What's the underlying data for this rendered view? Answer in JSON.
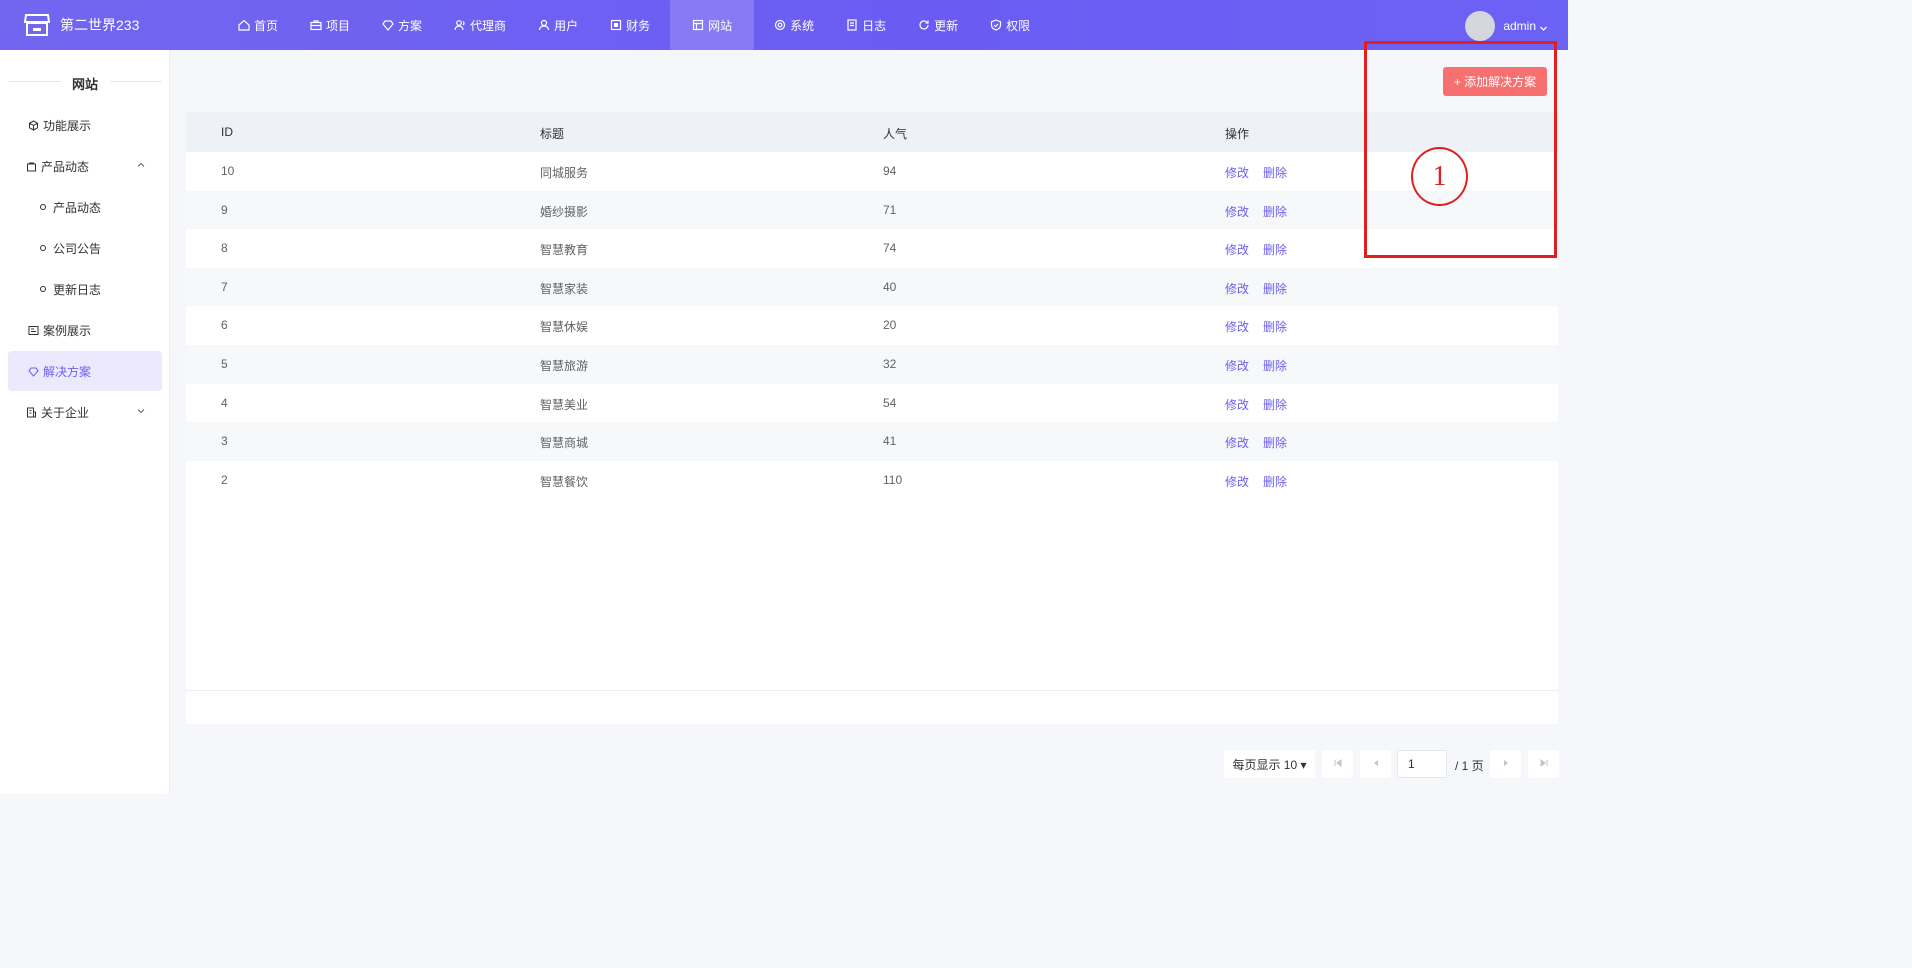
{
  "app": {
    "logo_text": "第二世界233"
  },
  "nav": {
    "items": [
      {
        "label": "首页",
        "icon": "home-icon"
      },
      {
        "label": "项目",
        "icon": "briefcase-icon"
      },
      {
        "label": "方案",
        "icon": "diamond-icon"
      },
      {
        "label": "代理商",
        "icon": "user-group-icon"
      },
      {
        "label": "用户",
        "icon": "user-icon"
      },
      {
        "label": "财务",
        "icon": "finance-icon"
      },
      {
        "label": "网站",
        "icon": "website-icon",
        "active": true
      },
      {
        "label": "系统",
        "icon": "gear-icon"
      },
      {
        "label": "日志",
        "icon": "log-icon"
      },
      {
        "label": "更新",
        "icon": "refresh-icon"
      },
      {
        "label": "权限",
        "icon": "shield-icon"
      }
    ]
  },
  "user": {
    "name": "admin"
  },
  "sidebar": {
    "title": "网站",
    "items": [
      {
        "label": "功能展示",
        "icon": "cube-icon"
      },
      {
        "label": "产品动态",
        "icon": "bag-icon",
        "expanded": true
      },
      {
        "label": "案例展示",
        "icon": "card-icon"
      },
      {
        "label": "解决方案",
        "icon": "diamond-icon",
        "active": true
      },
      {
        "label": "关于企业",
        "icon": "building-icon"
      }
    ],
    "sub_items": [
      "产品动态",
      "公司公告",
      "更新日志"
    ]
  },
  "toolbar": {
    "add_label": "+ 添加解决方案"
  },
  "table": {
    "headers": [
      "ID",
      "标题",
      "人气",
      "操作"
    ],
    "edit_label": "修改",
    "delete_label": "删除",
    "rows": [
      {
        "id": "10",
        "title": "同城服务",
        "popularity": "94"
      },
      {
        "id": "9",
        "title": "婚纱摄影",
        "popularity": "71"
      },
      {
        "id": "8",
        "title": "智慧教育",
        "popularity": "74"
      },
      {
        "id": "7",
        "title": "智慧家装",
        "popularity": "40"
      },
      {
        "id": "6",
        "title": "智慧休娱",
        "popularity": "20"
      },
      {
        "id": "5",
        "title": "智慧旅游",
        "popularity": "32"
      },
      {
        "id": "4",
        "title": "智慧美业",
        "popularity": "54"
      },
      {
        "id": "3",
        "title": "智慧商城",
        "popularity": "41"
      },
      {
        "id": "2",
        "title": "智慧餐饮",
        "popularity": "110"
      }
    ]
  },
  "pager": {
    "page_size_label": "每页显示 10 ▾",
    "current_page": "1",
    "total_label": "/ 1 页"
  },
  "annotation": {
    "number": "1"
  },
  "colors": {
    "accent": "#6c5ff0",
    "add_button": "#f77070",
    "annotation": "#e02020"
  }
}
